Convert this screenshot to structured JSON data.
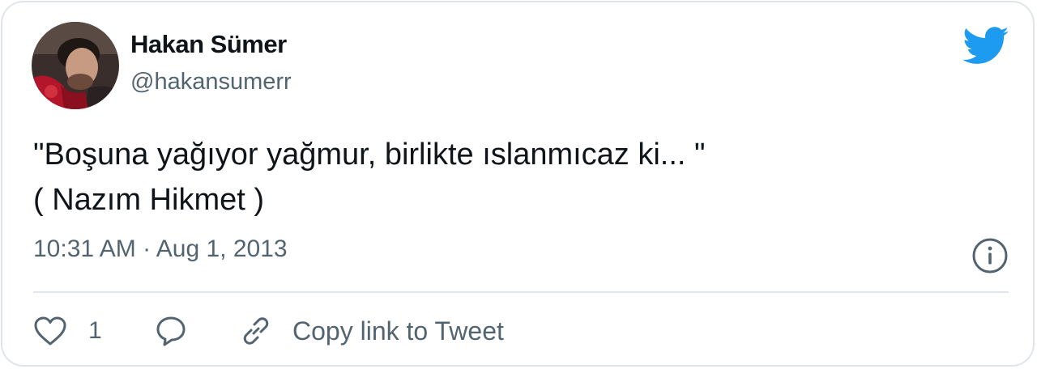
{
  "author": {
    "display_name": "Hakan Sümer",
    "handle": "@hakansumerr"
  },
  "tweet": {
    "lines": [
      "\"Boşuna yağıyor yağmur, birlikte ıslanmıcaz ki... \"",
      "( Nazım Hikmet )"
    ],
    "timestamp": "10:31 AM · Aug 1, 2013"
  },
  "actions": {
    "like_count": "1",
    "copy_link_label": "Copy link to Tweet"
  },
  "icons": {
    "brand": "twitter-bird-icon",
    "info": "info-icon",
    "like": "heart-icon",
    "reply": "reply-bubble-icon",
    "copy": "link-icon"
  },
  "colors": {
    "brand_blue": "#1d9bf0",
    "text_primary": "#0f1419",
    "text_secondary": "#536471",
    "border": "#dfe5ea"
  }
}
